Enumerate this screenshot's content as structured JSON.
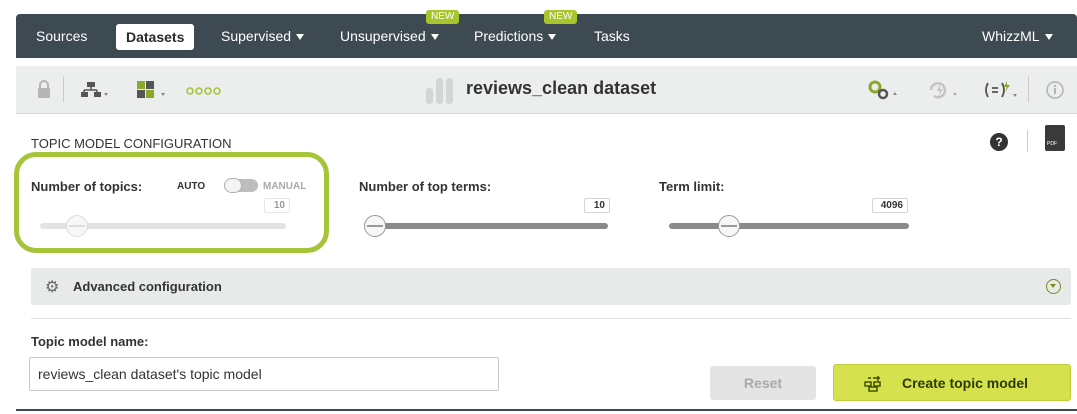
{
  "nav": {
    "items": [
      {
        "label": "Sources"
      },
      {
        "label": "Datasets",
        "active": true
      },
      {
        "label": "Supervised",
        "dropdown": true
      },
      {
        "label": "Unsupervised",
        "dropdown": true,
        "badge": "NEW"
      },
      {
        "label": "Predictions",
        "dropdown": true,
        "badge": "NEW"
      },
      {
        "label": "Tasks"
      }
    ],
    "right_label": "WhizzML"
  },
  "toolbar": {
    "dataset_title": "reviews_clean dataset",
    "icons": [
      "lock-icon",
      "tree-icon",
      "sample-icon",
      "dots-icon",
      "settings-gear-icon",
      "refresh-icon",
      "formula-icon",
      "info-icon"
    ]
  },
  "config": {
    "section_title": "TOPIC MODEL CONFIGURATION",
    "help_symbol": "?",
    "pdf_label": "PDF",
    "number_of_topics": {
      "label": "Number of topics:",
      "auto_label": "AUTO",
      "manual_label": "MANUAL",
      "mode": "AUTO",
      "value": "10",
      "fraction": 0.15
    },
    "top_terms": {
      "label": "Number of top terms:",
      "value": "10",
      "fraction": 0.03
    },
    "term_limit": {
      "label": "Term limit:",
      "value": "4096",
      "fraction": 0.25
    },
    "advanced_label": "Advanced configuration",
    "name_label": "Topic model name:",
    "name_value": "reviews_clean dataset's topic model"
  },
  "actions": {
    "reset_label": "Reset",
    "create_label": "Create topic model"
  },
  "colors": {
    "nav_bg": "#3d4a52",
    "accent_green": "#a6c43a",
    "create_btn": "#d6e24d",
    "badge": "#a8c62c"
  }
}
